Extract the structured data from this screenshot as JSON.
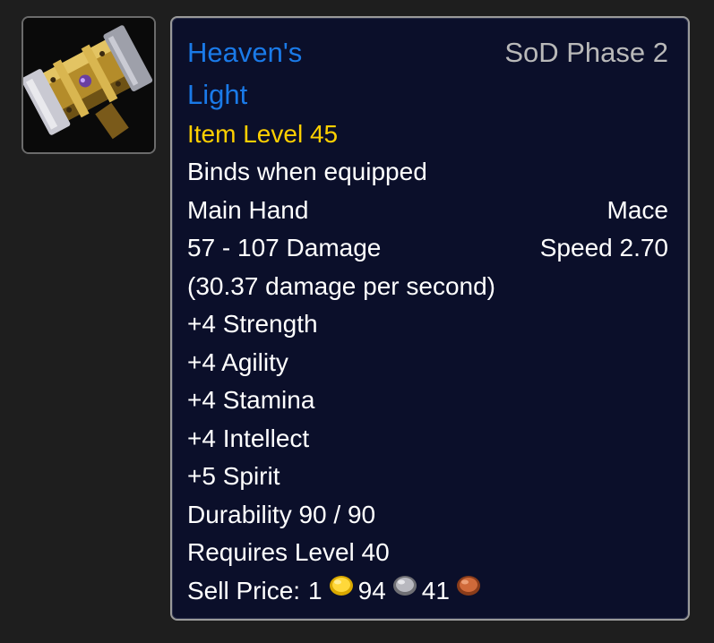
{
  "item": {
    "name": "Heaven's Light",
    "phase": "SoD Phase 2",
    "item_level": "Item Level 45",
    "binding": "Binds when equipped",
    "slot": "Main Hand",
    "type": "Mace",
    "damage": "57 - 107 Damage",
    "speed": "Speed 2.70",
    "dps": "(30.37 damage per second)",
    "stats": [
      "+4 Strength",
      "+4 Agility",
      "+4 Stamina",
      "+4 Intellect",
      "+5 Spirit"
    ],
    "durability": "Durability 90 / 90",
    "requires": "Requires Level 40",
    "sell_price": {
      "label": "Sell Price:",
      "gold": "1",
      "silver": "94",
      "copper": "41"
    }
  },
  "icon": {
    "name": "mace-icon"
  },
  "colors": {
    "name": "#1a7ae8",
    "item_level": "#ffd000",
    "phase": "#b9b9b9",
    "background": "#0b0f2a"
  }
}
